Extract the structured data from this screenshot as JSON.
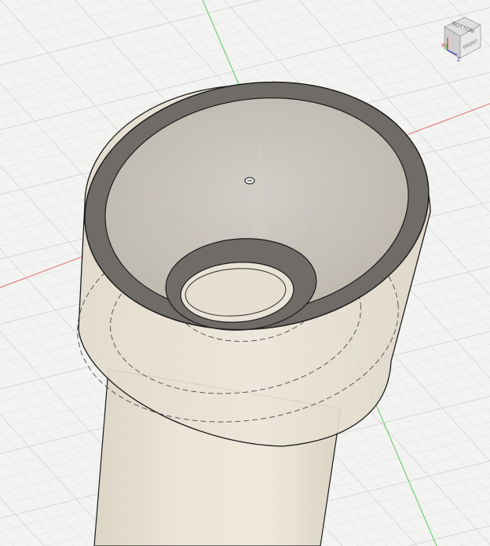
{
  "viewport": {
    "background_color": "#f3f3f1",
    "grid_minor_color": "#dcdcda",
    "grid_major_color": "#c9c9c6",
    "x_axis_color": "#e06a6a",
    "y_axis_color": "#5ec95e"
  },
  "model": {
    "body_color": "#e7e0d2",
    "wall_color": "#6f6c67",
    "edge_color": "#1c1c1c",
    "hidden_edge_style": "dashed"
  },
  "viewcube": {
    "top_face_label": "BOTTOM",
    "front_face_label": "FRONT",
    "axis_x_label": "X",
    "axis_z_label": "Z",
    "axis_x_color": "#d33",
    "axis_z_color": "#33b",
    "axis_y_color": "#3a3"
  },
  "origin": {
    "icon": "origin-point-icon"
  }
}
